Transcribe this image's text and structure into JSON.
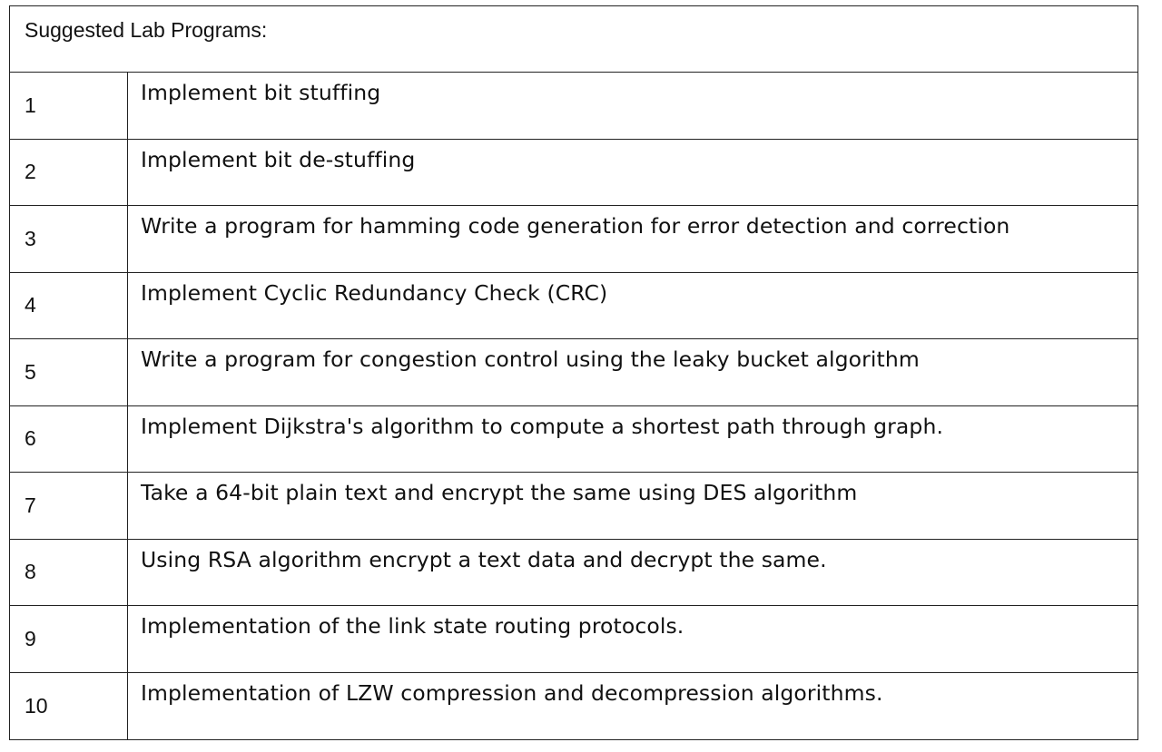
{
  "table": {
    "title": "Suggested Lab Programs:",
    "rows": [
      {
        "num": "1",
        "text": "Implement bit stuffing"
      },
      {
        "num": "2",
        "text": "Implement bit de-stuffing"
      },
      {
        "num": "3",
        "text": "Write a program for hamming code generation for error detection and correction"
      },
      {
        "num": "4",
        "text": "Implement Cyclic Redundancy Check (CRC)"
      },
      {
        "num": "5",
        "text": "Write a program for congestion control using the leaky bucket algorithm"
      },
      {
        "num": "6",
        "text": "Implement Dijkstra's algorithm to compute a shortest path through graph."
      },
      {
        "num": "7",
        "text": "Take a 64-bit plain text and encrypt the same using DES algorithm"
      },
      {
        "num": "8",
        "text": "Using RSA algorithm encrypt a text data and decrypt the same."
      },
      {
        "num": "9",
        "text": "Implementation of the link state routing protocols."
      },
      {
        "num": "10",
        "text": "Implementation of LZW compression and decompression algorithms."
      }
    ]
  }
}
